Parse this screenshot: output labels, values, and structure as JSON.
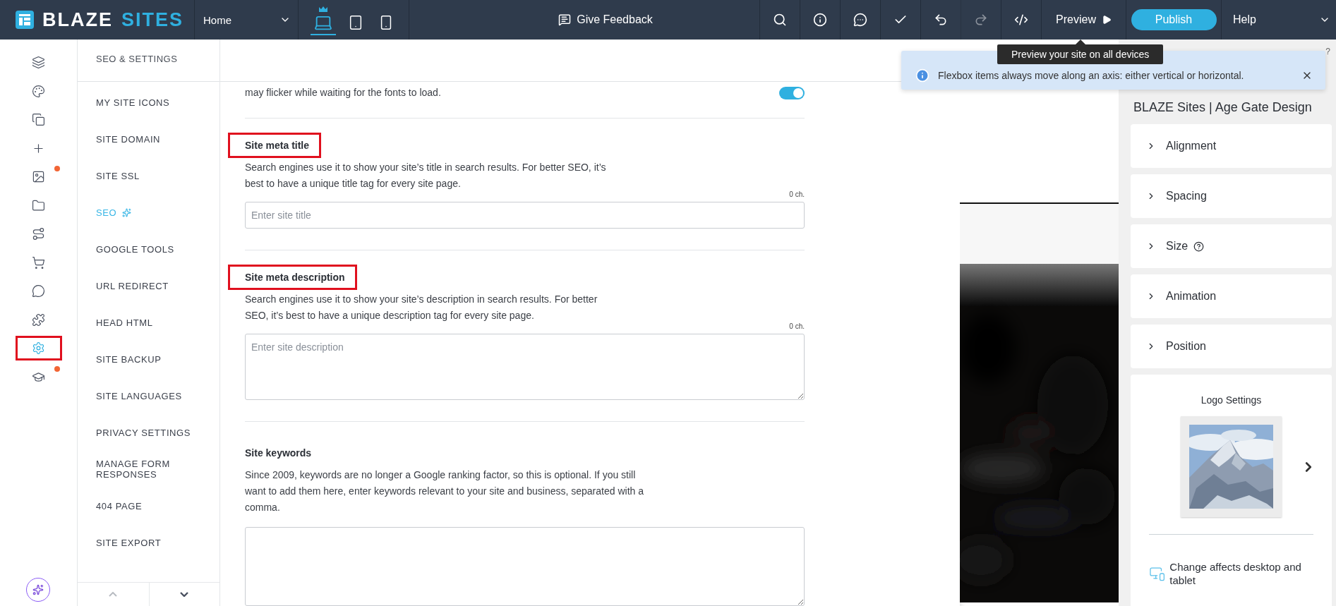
{
  "topbar": {
    "brand_primary": "BLAZE",
    "brand_secondary": "SITES",
    "page_select": {
      "value": "Home"
    },
    "devices": [
      {
        "kind": "desktop",
        "selected": true
      },
      {
        "kind": "tablet",
        "selected": false
      },
      {
        "kind": "mobile",
        "selected": false
      }
    ],
    "feedback": "Give Feedback",
    "tools": [
      {
        "kind": "search",
        "disabled": false
      },
      {
        "kind": "info",
        "disabled": false
      },
      {
        "kind": "comment",
        "disabled": false
      },
      {
        "kind": "check",
        "disabled": false
      },
      {
        "kind": "undo",
        "disabled": false
      },
      {
        "kind": "redo",
        "disabled": true
      },
      {
        "kind": "code",
        "disabled": false
      }
    ],
    "preview": "Preview",
    "publish": "Publish",
    "help": "Help"
  },
  "rail": [
    {
      "kind": "layers",
      "selected": false,
      "badge": false
    },
    {
      "kind": "palette",
      "selected": false,
      "badge": false
    },
    {
      "kind": "pages",
      "selected": false,
      "badge": false
    },
    {
      "kind": "add",
      "selected": false,
      "badge": false
    },
    {
      "kind": "media",
      "selected": false,
      "badge": true
    },
    {
      "kind": "folder",
      "selected": false,
      "badge": false
    },
    {
      "kind": "route",
      "selected": false,
      "badge": false
    },
    {
      "kind": "cart",
      "selected": false,
      "badge": false
    },
    {
      "kind": "chat",
      "selected": false,
      "badge": false
    },
    {
      "kind": "apps",
      "selected": false,
      "badge": false
    },
    {
      "kind": "settings",
      "selected": true,
      "badge": false
    },
    {
      "kind": "learn",
      "selected": false,
      "badge": true
    }
  ],
  "settings_nav": {
    "title": "SEO & SETTINGS",
    "items": [
      {
        "label": "MY SITE ICONS",
        "selected": false,
        "sparkle": false
      },
      {
        "label": "SITE DOMAIN",
        "selected": false,
        "sparkle": false
      },
      {
        "label": "SITE SSL",
        "selected": false,
        "sparkle": false
      },
      {
        "label": "SEO",
        "selected": true,
        "sparkle": true
      },
      {
        "label": "GOOGLE TOOLS",
        "selected": false,
        "sparkle": false
      },
      {
        "label": "URL REDIRECT",
        "selected": false,
        "sparkle": false
      },
      {
        "label": "HEAD HTML",
        "selected": false,
        "sparkle": false
      },
      {
        "label": "SITE BACKUP",
        "selected": false,
        "sparkle": false
      },
      {
        "label": "SITE LANGUAGES",
        "selected": false,
        "sparkle": false
      },
      {
        "label": "PRIVACY SETTINGS",
        "selected": false,
        "sparkle": false
      },
      {
        "label": "MANAGE FORM RESPONSES",
        "selected": false,
        "sparkle": false
      },
      {
        "label": "404 PAGE",
        "selected": false,
        "sparkle": false
      },
      {
        "label": "SITE EXPORT",
        "selected": false,
        "sparkle": false
      }
    ]
  },
  "content": {
    "intro": "may flicker while waiting for the fonts to load.",
    "intro_toggle": {
      "on": true
    },
    "sections": [
      {
        "kind": "input",
        "title": "Site meta title",
        "highlighted": true,
        "description": "Search engines use it to show your site’s title in search results. For better SEO, it’s best to have a unique title tag for every site page.",
        "counter": "0 ch.",
        "placeholder": "Enter site title"
      },
      {
        "kind": "textarea",
        "title": "Site meta description",
        "highlighted": true,
        "description": "Search engines use it to show your site’s description in search results. For better SEO, it’s best to have a unique description tag for every site page.",
        "counter": "0 ch.",
        "placeholder": "Enter site description"
      },
      {
        "kind": "textarea",
        "title": "Site keywords",
        "highlighted": false,
        "description": "Since 2009, keywords are no longer a Google ranking factor, so this is optional. If you still want to add them here, enter keywords relevant to your site and business, separated with a comma."
      }
    ]
  },
  "toast": {
    "message": "Flexbox items always move along an axis: either vertical or horizontal."
  },
  "tooltip": "Preview your site on all devices",
  "inspector": {
    "help": "?",
    "title": "BLAZE Sites | Age Gate Design",
    "sections": [
      {
        "label": "Alignment",
        "help": false
      },
      {
        "label": "Spacing",
        "help": false
      },
      {
        "label": "Size",
        "help": true
      },
      {
        "label": "Animation",
        "help": false
      },
      {
        "label": "Position",
        "help": false
      }
    ],
    "logo": {
      "title": "Logo Settings",
      "note": "Change affects desktop and tablet"
    }
  }
}
